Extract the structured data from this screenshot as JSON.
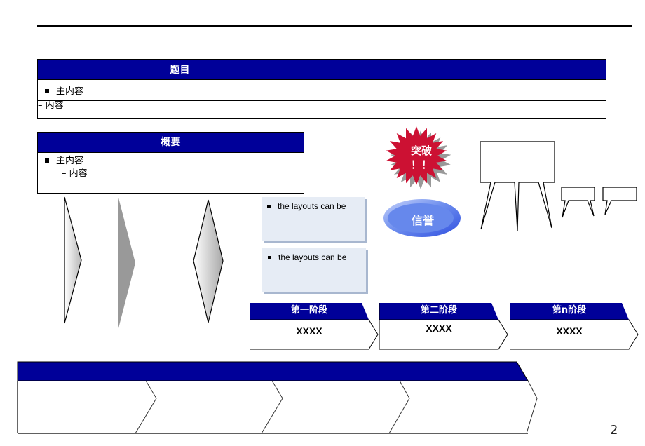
{
  "page_number": "2",
  "table": {
    "header_left": "题目",
    "header_right": "",
    "rows": [
      {
        "left": "主内容",
        "right": "",
        "style": "bullet"
      },
      {
        "left": "– 内容",
        "right": "",
        "style": "sub"
      }
    ]
  },
  "summary": {
    "title": "概要",
    "main": "主内容",
    "sub": "– 内容"
  },
  "cards": [
    {
      "text": "the layouts can be"
    },
    {
      "text": "the layouts can be"
    }
  ],
  "starburst": {
    "line1": "突破",
    "line2": "！！",
    "color": "#cc1133"
  },
  "oval": {
    "text": "信誉",
    "color": "#5b7fe8"
  },
  "stages": [
    {
      "label": "第一阶段",
      "value": "XXXX"
    },
    {
      "label": "第二阶段",
      "value": "XXXX"
    },
    {
      "label": "第n阶段",
      "value": "XXXX"
    }
  ],
  "colors": {
    "navy": "#000099",
    "card_bg": "#e6ecf5",
    "card_shadow": "#a8b7cf"
  }
}
